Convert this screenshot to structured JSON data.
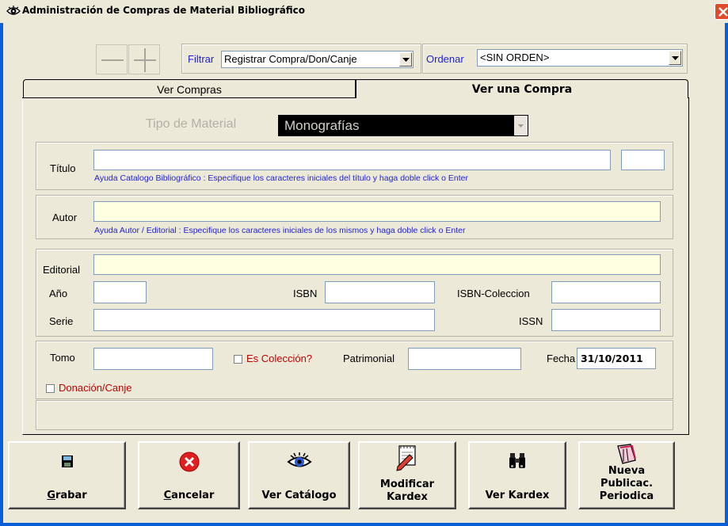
{
  "window": {
    "title": "Administración de Compras de Material Bibliográfico"
  },
  "toolbar": {
    "filter_label": "Filtrar",
    "filter_value": "Registrar Compra/Don/Canje",
    "order_label": "Ordenar",
    "order_value": "<SIN ORDEN>"
  },
  "tabs": [
    {
      "label": "Ver Compras",
      "active": false
    },
    {
      "label": "Ver una Compra",
      "active": true
    }
  ],
  "material": {
    "label": "Tipo de Material",
    "value": "Monografías"
  },
  "titulo": {
    "label": "Título",
    "value": "",
    "hint": "Ayuda Catalogo Bibliográfico : Especifique los caracteres iniciales del título y haga doble click o Enter"
  },
  "autor": {
    "label": "Autor",
    "value": "",
    "hint": "Ayuda Autor / Editorial : Especifique los caracteres iniciales de los mismos y haga doble click o Enter"
  },
  "publicacion": {
    "editorial_label": "Editorial",
    "anio_label": "Año",
    "isbn_label": "ISBN",
    "isbn_coleccion_label": "ISBN-Coleccion",
    "serie_label": "Serie",
    "issn_label": "ISSN"
  },
  "detalle": {
    "tomo_label": "Tomo",
    "es_coleccion_label": "Es Colección?",
    "es_coleccion_checked": false,
    "patrimonial_label": "Patrimonial",
    "fecha_label": "Fecha",
    "fecha_value": "31/10/2011",
    "donacion_label": "Donación/Canje",
    "donacion_checked": false
  },
  "buttons": {
    "grabar_prefix": "G",
    "grabar_rest": "rabar",
    "cancelar_prefix": "C",
    "cancelar_rest": "ancelar",
    "ver_catalogo": "Ver Catálogo",
    "modificar_kardex_1": "Modificar",
    "modificar_kardex_2": "Kardex",
    "ver_kardex": "Ver Kardex",
    "nueva_pub_1": "Nueva",
    "nueva_pub_2": "Publicac.",
    "nueva_pub_3": "Periodica"
  },
  "colors": {
    "window_frame": "#0a5fd8",
    "face": "#ece9d8",
    "yellow_field": "#ffffe1",
    "hint_blue": "#1f1fd0",
    "red_label": "#c00000",
    "material_bg": "#000000",
    "material_text": "#d4d0c8"
  },
  "icons": [
    "app-eye-icon",
    "close-icon",
    "minus-icon",
    "plus-icon",
    "save-disk-icon",
    "cancel-x-icon",
    "eye-icon",
    "notepad-pencil-icon",
    "binoculars-icon",
    "notebook-icon",
    "dropdown-arrow-icon"
  ]
}
